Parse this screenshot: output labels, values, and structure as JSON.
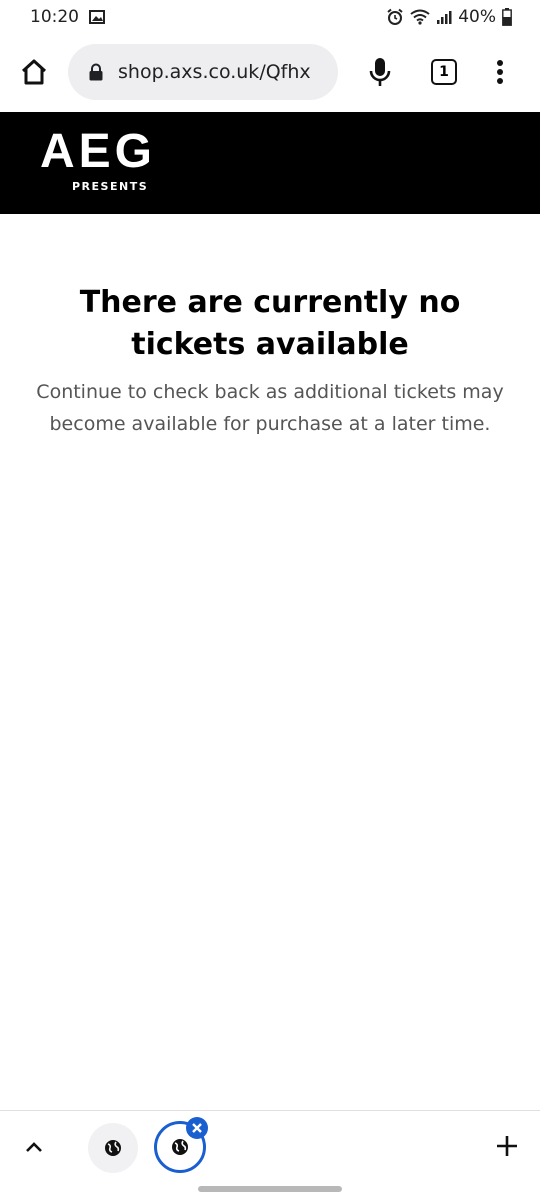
{
  "status_bar": {
    "time": "10:20",
    "battery": "40%",
    "icons": [
      "image-icon",
      "alarm-icon",
      "wifi-icon",
      "signal-icon",
      "battery-icon"
    ]
  },
  "browser": {
    "url": "shop.axs.co.uk/Qfhx",
    "tab_count": "1",
    "icons": [
      "home-icon",
      "lock-icon",
      "mic-icon",
      "tabs-icon",
      "more-vert-icon"
    ]
  },
  "site": {
    "logo_main": "AEG",
    "logo_sub": "PRESENTS",
    "header_color": "#000000"
  },
  "message": {
    "title": "There are currently no tickets available",
    "body": "Continue to check back as additional tickets may become available for purchase at a later time."
  },
  "bottom_bar": {
    "icons": [
      "chevron-up-icon",
      "globe-icon",
      "globe-icon",
      "close-icon",
      "plus-icon"
    ],
    "accent": "#1a5fd0"
  }
}
